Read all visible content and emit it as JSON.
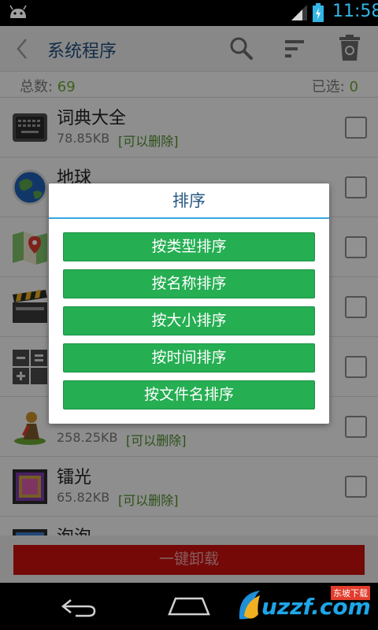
{
  "status_bar": {
    "time": "11:58"
  },
  "app_bar": {
    "title": "系统程序"
  },
  "summary": {
    "total_label": "总数: ",
    "total_value": "69",
    "selected_label": "已选: ",
    "selected_value": "0"
  },
  "apps": [
    {
      "name": "词典大全",
      "size": "78.85KB",
      "status": "[可以删除]",
      "icon": "keyboard-icon"
    },
    {
      "name": "地球",
      "size": "",
      "status": "",
      "icon": "earth-icon"
    },
    {
      "name": "",
      "size": "",
      "status": "",
      "icon": "maps-icon"
    },
    {
      "name": "",
      "size": "",
      "status": "",
      "icon": "movie-studio-icon"
    },
    {
      "name": "",
      "size": "",
      "status": "",
      "icon": "calculator-icon"
    },
    {
      "name": "",
      "size": "258.25KB",
      "status": "[可以删除]",
      "icon": "person-marker-icon"
    },
    {
      "name": "镭光",
      "size": "65.82KB",
      "status": "[可以删除]",
      "icon": "live-wallpaper-icon"
    },
    {
      "name": "泡泡",
      "size": "",
      "status": "",
      "icon": "bubbles-wallpaper-icon"
    }
  ],
  "bottom_bar": {
    "uninstall_label": "一键卸载"
  },
  "sort_dialog": {
    "title": "排序",
    "options": [
      "按类型排序",
      "按名称排序",
      "按大小排序",
      "按时间排序",
      "按文件名排序"
    ]
  },
  "watermark": {
    "text": "uzzf.com",
    "tag": "东坡下载"
  },
  "colors": {
    "accent_blue": "#34a8de",
    "option_green": "#25ae52",
    "uninstall_red": "#c9100f"
  }
}
